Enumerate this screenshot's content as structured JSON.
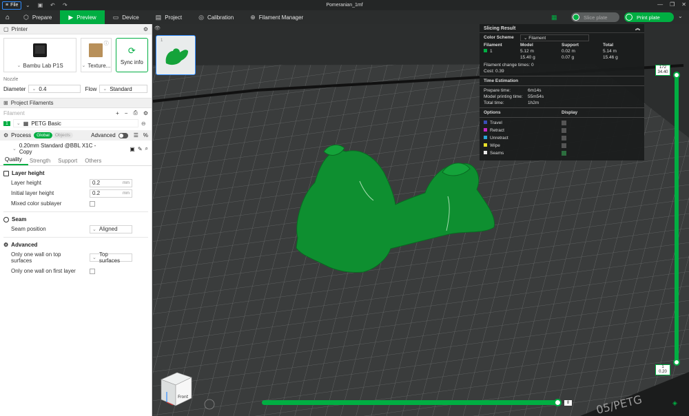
{
  "app": {
    "file_label": "File",
    "window_title": "Pomeranian_1mf"
  },
  "menu": {
    "tabs": [
      {
        "label": "Prepare"
      },
      {
        "label": "Preview"
      },
      {
        "label": "Device"
      },
      {
        "label": "Project"
      },
      {
        "label": "Calibration"
      },
      {
        "label": "Filament Manager"
      }
    ],
    "slice_label": "Slice plate",
    "print_label": "Print plate"
  },
  "printer": {
    "section_title": "Printer",
    "printer_name": "Bambu Lab P1S",
    "plate_name": "Texture...",
    "sync_label": "Sync info",
    "nozzle_label": "Nozzle",
    "diameter_label": "Diameter",
    "diameter_value": "0.4",
    "flow_label": "Flow",
    "flow_value": "Standard"
  },
  "filaments": {
    "section_title": "Project Filaments",
    "sub_label": "Filament",
    "items": [
      {
        "index": "1",
        "name": "PETG Basic",
        "color": "#00ae42"
      }
    ]
  },
  "process": {
    "title": "Process",
    "global_label": "Global",
    "objects_label": "Objects",
    "advanced_label": "Advanced",
    "preset": "0.20mm Standard @BBL X1C - Copy",
    "tabs": [
      "Quality",
      "Strength",
      "Support",
      "Others"
    ],
    "layer_group": "Layer height",
    "layer_height_label": "Layer height",
    "layer_height_value": "0.2",
    "initial_layer_label": "Initial layer height",
    "initial_layer_value": "0.2",
    "unit": "mm",
    "mixed_color_label": "Mixed color sublayer",
    "seam_group": "Seam",
    "seam_position_label": "Seam position",
    "seam_position_value": "Aligned",
    "advanced_group": "Advanced",
    "one_wall_top_label": "Only one wall on top surfaces",
    "one_wall_top_value": "Top surfaces",
    "one_wall_first_label": "Only one wall on first layer"
  },
  "viewport": {
    "plate_number": "1",
    "plate_text": "05/PETG",
    "cube_label": "Front"
  },
  "slicing": {
    "title": "Slicing Result",
    "color_scheme_label": "Color Scheme",
    "color_scheme_value": "Filament",
    "headers": [
      "Filament",
      "Model",
      "Support",
      "Total"
    ],
    "row": {
      "index": "1",
      "color": "#00ae42",
      "model_m": "5.12 m",
      "model_g": "15.40 g",
      "support_m": "0.02 m",
      "support_g": "0.07 g",
      "total_m": "5.14 m",
      "total_g": "15.46 g"
    },
    "change_times": "Filament change times:  0",
    "cost": "Cost:  0.39",
    "time_title": "Time Estimation",
    "prepare_label": "Prepare time:",
    "prepare_value": "6m14s",
    "model_time_label": "Model printing time:",
    "model_time_value": "55m54s",
    "total_time_label": "Total time:",
    "total_time_value": "1h2m",
    "options_label": "Options",
    "display_label": "Display",
    "options": [
      {
        "name": "Travel",
        "color": "#3a4fb8",
        "checked": false
      },
      {
        "name": "Retract",
        "color": "#c72ac4",
        "checked": false
      },
      {
        "name": "Unretract",
        "color": "#2aa6d6",
        "checked": false
      },
      {
        "name": "Wipe",
        "color": "#e8e02a",
        "checked": false
      },
      {
        "name": "Seams",
        "color": "#e8e8e8",
        "checked": true
      }
    ]
  },
  "layers": {
    "top_layer": "172",
    "top_height": "34.40",
    "bottom_layer": "1",
    "bottom_height": "0.20",
    "move_value": "8"
  }
}
